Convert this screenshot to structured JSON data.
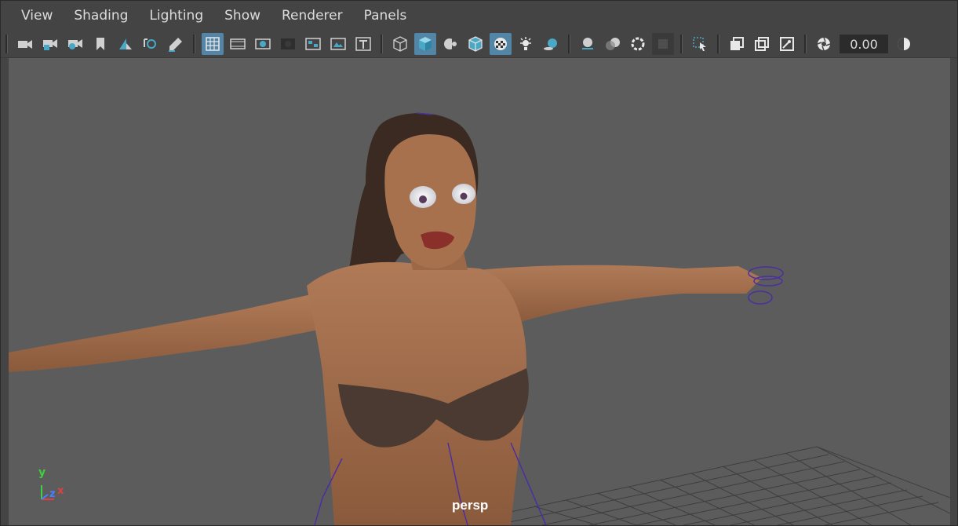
{
  "menu": {
    "view": "View",
    "shading": "Shading",
    "lighting": "Lighting",
    "show": "Show",
    "renderer": "Renderer",
    "panels": "Panels"
  },
  "toolbar": {
    "exposure_value": "0.00",
    "accent_color": "#5285a6",
    "icons": [
      "camera-icon",
      "lock-camera-icon",
      "camera-attributes-icon",
      "bookmark-icon",
      "image-plane-icon",
      "two-d-pan-zoom-icon",
      "grease-pencil-icon",
      "grid-icon",
      "film-gate-icon",
      "resolution-gate-icon",
      "gate-mask-icon",
      "field-chart-icon",
      "safe-action-icon",
      "safe-title-icon",
      "wireframe-icon",
      "smooth-shade-icon",
      "default-material-icon",
      "wireframe-on-shaded-icon",
      "textured-icon",
      "use-all-lights-icon",
      "shadows-icon",
      "screen-space-ambient-occlusion-icon",
      "motion-blur-icon",
      "multisample-aa-icon",
      "depth-of-field-icon",
      "isolate-select-icon",
      "xray-icon",
      "xray-active-components-icon",
      "xray-joints-icon",
      "exposure-icon",
      "gamma-icon"
    ]
  },
  "viewport": {
    "camera_label": "persp",
    "axis_labels": {
      "x": "x",
      "y": "y",
      "z": "z"
    },
    "background_color": "#5c5c5c"
  }
}
